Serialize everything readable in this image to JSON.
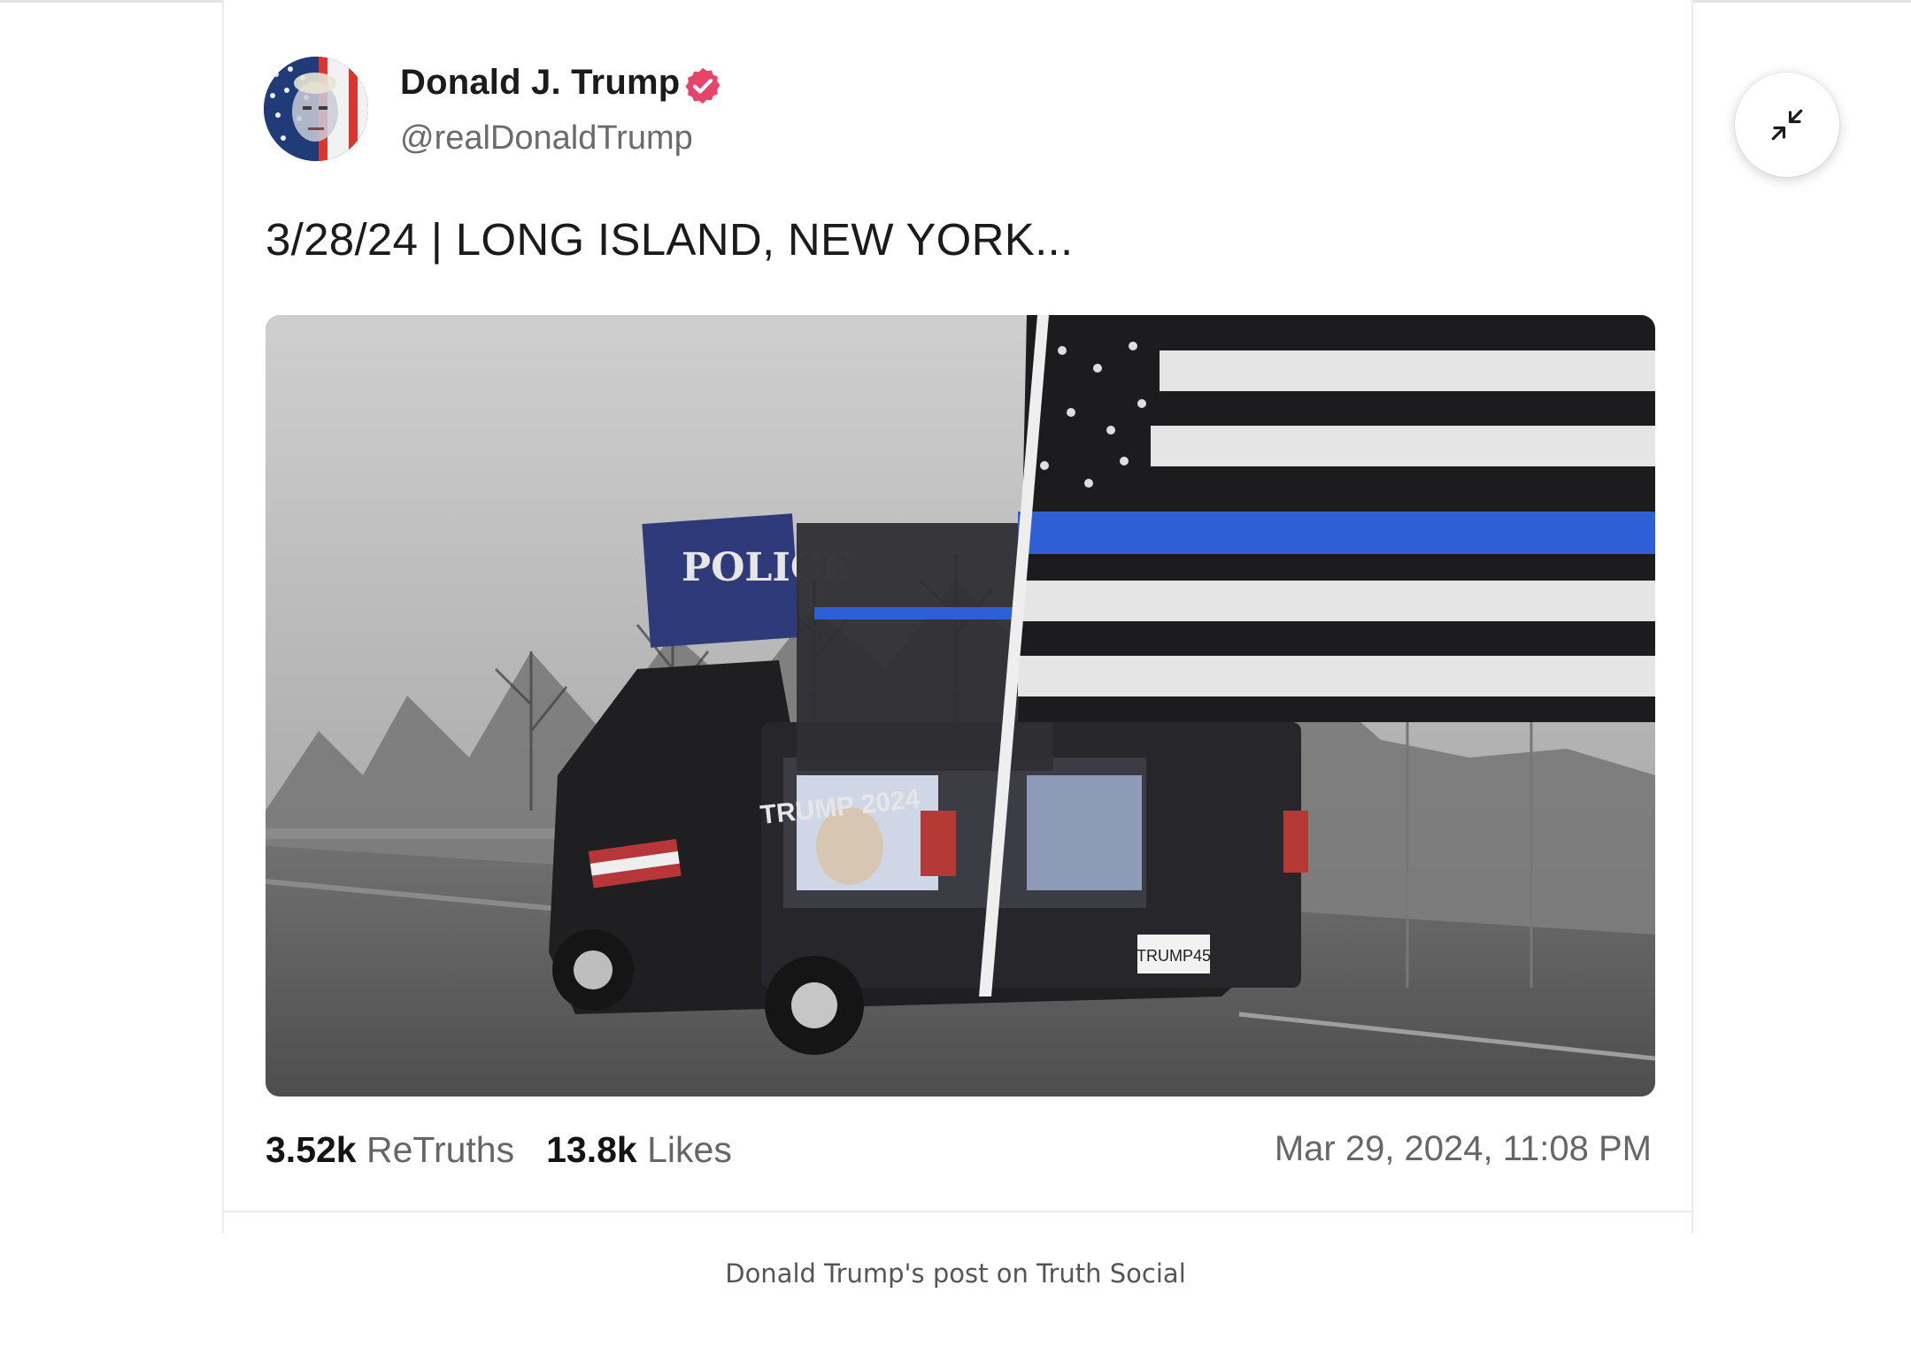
{
  "post": {
    "author_name": "Donald J. Trump",
    "handle": "@realDonaldTrump",
    "verified_icon": "verified-badge-icon",
    "text": "3/28/24 | LONG ISLAND, NEW YORK...",
    "media": {
      "truck_decal": "TRUMP 2024",
      "plate": "TRUMP45"
    },
    "stats": {
      "retruths_count": "3.52k",
      "retruths_label": "ReTruths",
      "likes_count": "13.8k",
      "likes_label": "Likes"
    },
    "date": "Mar 29, 2024, 11:08 PM"
  },
  "controls": {
    "collapse_icon": "collapse-arrows-icon"
  },
  "caption": "Donald Trump's post on Truth Social",
  "colors": {
    "verified": "#e8436a",
    "text_primary": "#1b1b1b",
    "text_secondary": "#6b6b6b",
    "flag_blue_line": "#2f5fd6"
  }
}
